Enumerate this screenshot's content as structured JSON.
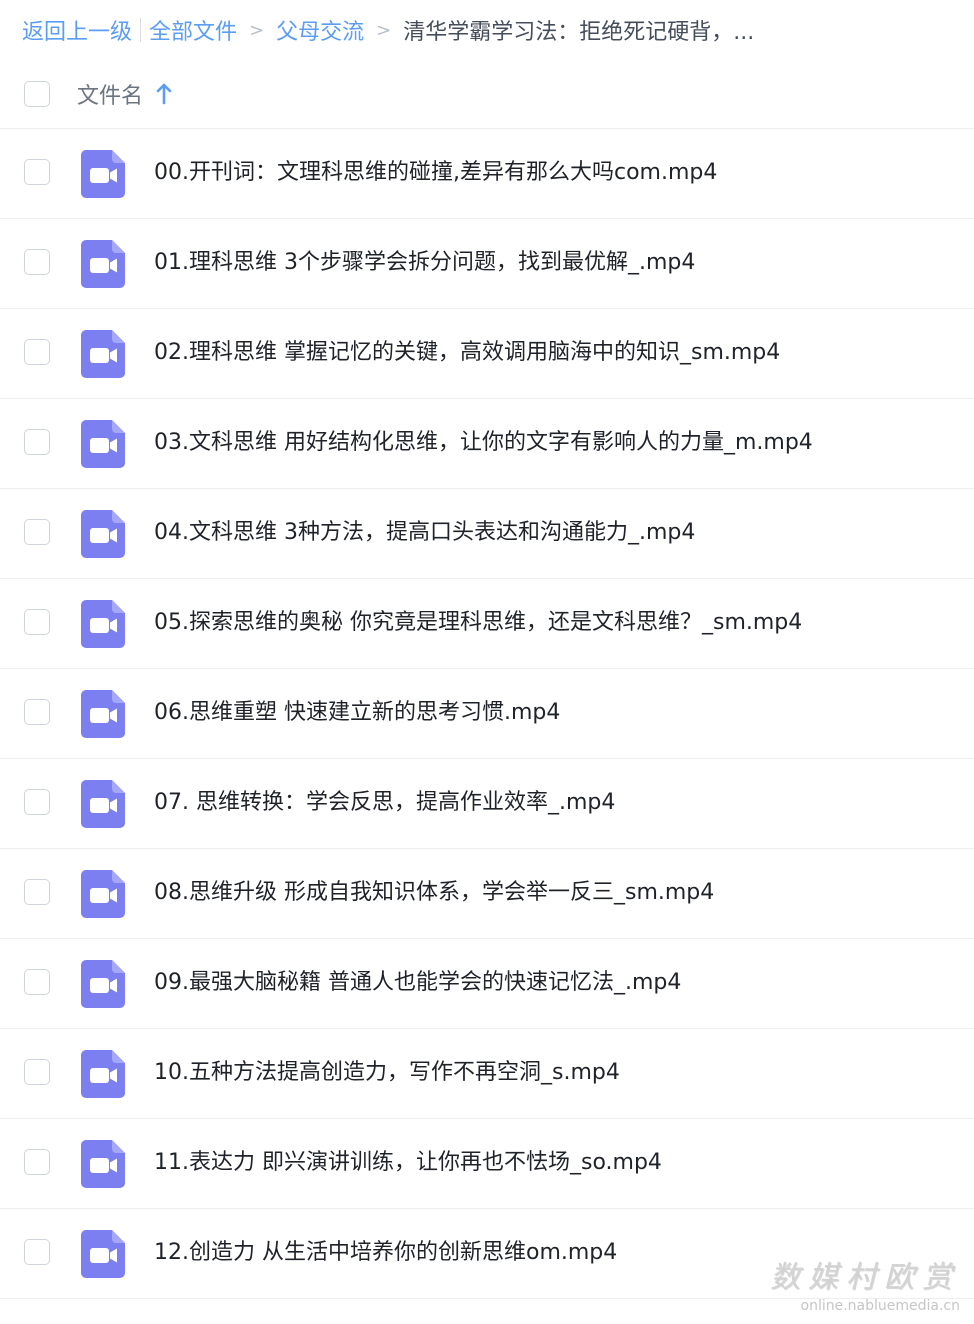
{
  "breadcrumb": {
    "back": "返回上一级",
    "all_files": "全部文件",
    "separator": ">",
    "parent": "父母交流",
    "current": "清华学霸学习法：拒绝死记硬背，..."
  },
  "header": {
    "column_label": "文件名",
    "sort_icon": "arrow-up-icon"
  },
  "colors": {
    "link": "#5b9df5",
    "video_icon": "#7b7ff0",
    "text": "#1f2329"
  },
  "files": [
    {
      "name": "00.开刊词：文理科思维的碰撞,差异有那么大吗com.mp4",
      "icon": "video-file-icon"
    },
    {
      "name": "01.理科思维 3个步骤学会拆分问题，找到最优解_.mp4",
      "icon": "video-file-icon"
    },
    {
      "name": "02.理科思维 掌握记忆的关键，高效调用脑海中的知识_sm.mp4",
      "icon": "video-file-icon"
    },
    {
      "name": "03.文科思维 用好结构化思维，让你的文字有影响人的力量_m.mp4",
      "icon": "video-file-icon"
    },
    {
      "name": "04.文科思维 3种方法，提高口头表达和沟通能力_.mp4",
      "icon": "video-file-icon"
    },
    {
      "name": "05.探索思维的奥秘 你究竟是理科思维，还是文科思维？_sm.mp4",
      "icon": "video-file-icon"
    },
    {
      "name": "06.思维重塑 快速建立新的思考习惯.mp4",
      "icon": "video-file-icon"
    },
    {
      "name": "07. 思维转换：学会反思，提高作业效率_.mp4",
      "icon": "video-file-icon"
    },
    {
      "name": "08.思维升级 形成自我知识体系，学会举一反三_sm.mp4",
      "icon": "video-file-icon"
    },
    {
      "name": "09.最强大脑秘籍 普通人也能学会的快速记忆法_.mp4",
      "icon": "video-file-icon"
    },
    {
      "name": "10.五种方法提高创造力，写作不再空洞_s.mp4",
      "icon": "video-file-icon"
    },
    {
      "name": "11.表达力 即兴演讲训练，让你再也不怯场_so.mp4",
      "icon": "video-file-icon"
    },
    {
      "name": "12.创造力 从生活中培养你的创新思维om.mp4",
      "icon": "video-file-icon"
    }
  ],
  "watermark": {
    "main": "数媒村欧赏",
    "sub": "online.nabluemedia.cn"
  }
}
